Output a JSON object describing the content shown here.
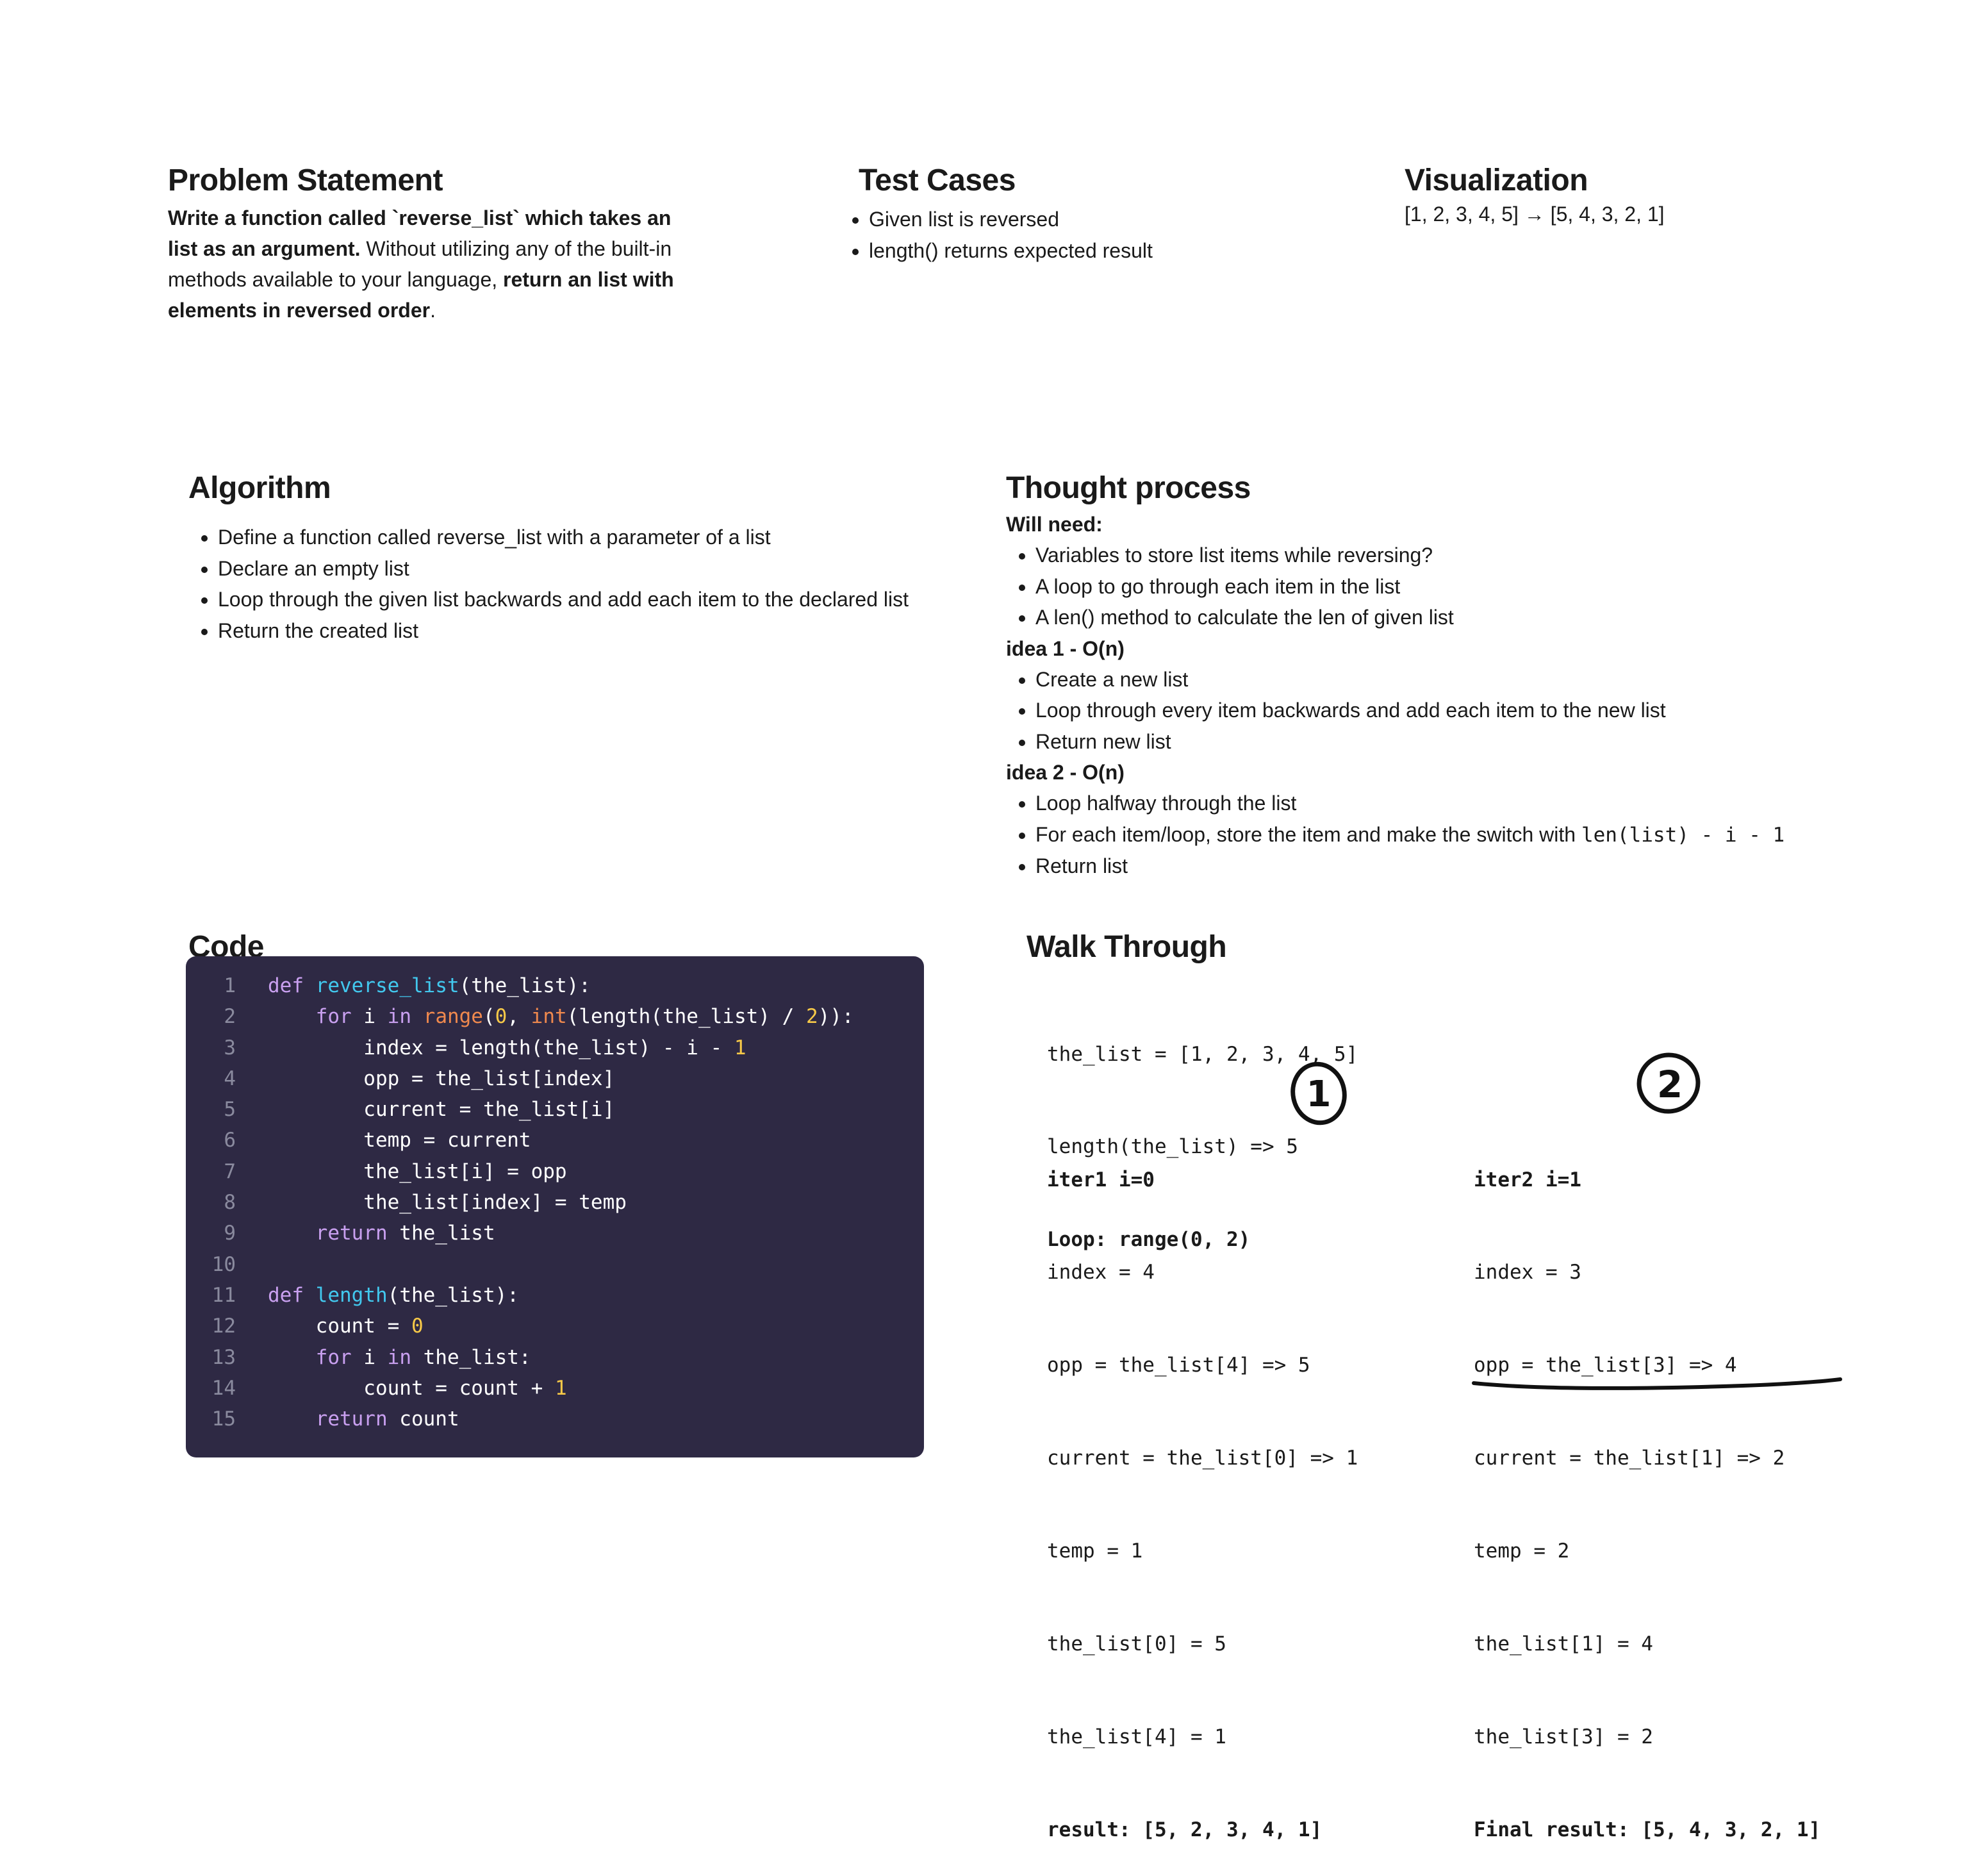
{
  "problem": {
    "title": "Problem Statement",
    "bold1": "Write a function called `reverse_list` which takes an list as an argument.",
    "plain1": " Without utilizing any of the built-in methods available to your language, ",
    "bold2": "return an list with elements in reversed order",
    "plain2": "."
  },
  "tests": {
    "title": "Test Cases",
    "items": [
      "Given list is reversed",
      "length() returns expected result"
    ]
  },
  "visualization": {
    "title": "Visualization",
    "text": "[1, 2, 3, 4, 5] → [5, 4, 3, 2, 1]"
  },
  "algorithm": {
    "title": "Algorithm",
    "items": [
      "Define a function called reverse_list with a parameter of a list",
      "Declare an empty list",
      "Loop through the given list backwards and add each item to the declared list",
      "Return the created list"
    ]
  },
  "thought": {
    "title": "Thought process",
    "need_label": "Will need:",
    "need_items": [
      "Variables to store list items while reversing?",
      "A loop to go through each item in the list",
      " A len() method to calculate the len of given list"
    ],
    "idea1_label": "idea 1 - O(n)",
    "idea1_items": [
      "Create a new list",
      "Loop through every item backwards and add each item to the new list",
      "Return new list"
    ],
    "idea2_label": "idea 2 - O(n)",
    "idea2_items": [
      "Loop halfway through the list",
      "For each item/loop, store the item and make the switch with ",
      "Return list"
    ],
    "idea2_code": "len(list) - i - 1"
  },
  "code": {
    "title": "Code",
    "line_numbers": [
      "1",
      "2",
      "3",
      "4",
      "5",
      "6",
      "7",
      "8",
      "9",
      "10",
      "11",
      "12",
      "13",
      "14",
      "15"
    ]
  },
  "walk": {
    "title": "Walk Through",
    "intro": [
      "the_list = [1, 2, 3, 4, 5]",
      "length(the_list) => 5",
      "Loop: range(0, 2)"
    ],
    "iter1": [
      "iter1 i=0",
      "index = 4",
      "opp = the_list[4] => 5",
      "current = the_list[0] => 1",
      "temp = 1",
      "the_list[0] = 5",
      "the_list[4] = 1",
      "result: [5, 2, 3, 4, 1]"
    ],
    "iter2": [
      "iter2 i=1",
      "index = 3",
      "opp = the_list[3] => 4",
      "current = the_list[1] => 2",
      "temp = 2",
      "the_list[1] = 4",
      "the_list[3] = 2",
      "Final result: [5, 4, 3, 2, 1]"
    ],
    "mark1": "1",
    "mark2": "2"
  }
}
